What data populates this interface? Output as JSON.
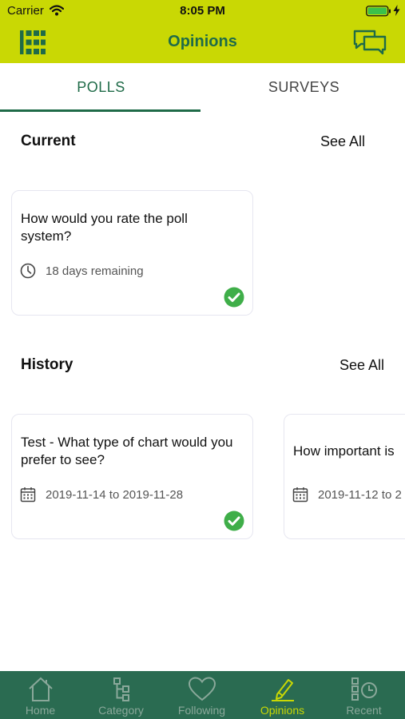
{
  "status_bar": {
    "carrier": "Carrier",
    "time": "8:05 PM"
  },
  "nav": {
    "title": "Opinions",
    "left_icon": "grid-menu-icon",
    "right_icon": "chat-bubbles-icon"
  },
  "tabs": [
    {
      "label": "POLLS",
      "active": true
    },
    {
      "label": "SURVEYS",
      "active": false
    }
  ],
  "current": {
    "title": "Current",
    "see_all": "See All",
    "cards": [
      {
        "question": "How would you rate the poll system?",
        "meta": "18 days remaining",
        "meta_icon": "clock-icon",
        "answered": true
      }
    ]
  },
  "history": {
    "title": "History",
    "see_all": "See All",
    "cards": [
      {
        "question": "Test - What type of chart would you prefer to see?",
        "meta": "2019-11-14 to 2019-11-28",
        "meta_icon": "calendar-icon",
        "answered": true
      },
      {
        "question": "How important is",
        "meta": "2019-11-12 to 2",
        "meta_icon": "calendar-icon",
        "answered": false
      }
    ]
  },
  "tabbar": [
    {
      "label": "Home",
      "icon": "home-icon",
      "active": false
    },
    {
      "label": "Category",
      "icon": "category-tree-icon",
      "active": false
    },
    {
      "label": "Following",
      "icon": "heart-icon",
      "active": false
    },
    {
      "label": "Opinions",
      "icon": "opinions-pen-icon",
      "active": true
    },
    {
      "label": "Recent",
      "icon": "recent-clock-icon",
      "active": false
    }
  ],
  "colors": {
    "header": "#c9d804",
    "primary": "#1f6b48",
    "tabbar": "#2a6b51",
    "check": "#3fae49",
    "active_tab_label": "#c9d804"
  }
}
